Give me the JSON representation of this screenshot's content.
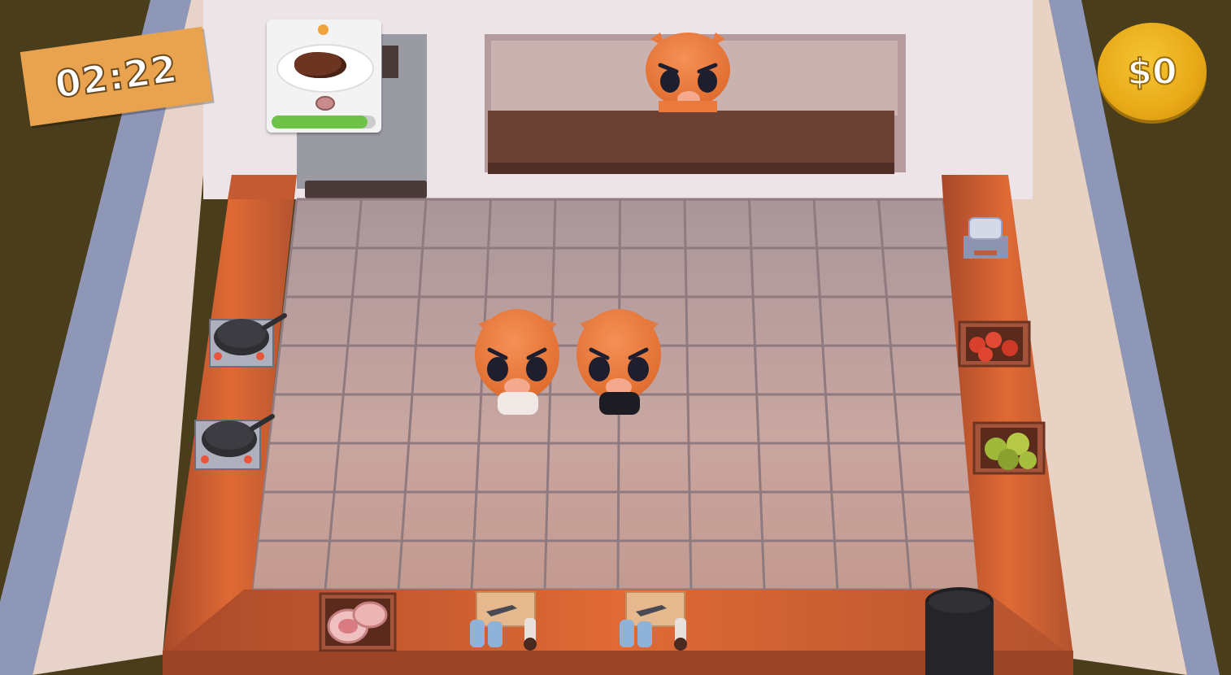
{
  "hud": {
    "timer": "02:22",
    "money": "$0"
  },
  "order": {
    "dish_icon": "steak-icon",
    "ingredient_icon": "raw-meat-icon",
    "progress": 0.92,
    "colors": {
      "progress": "#6ec248",
      "indicator": "#f0a33a"
    }
  },
  "colors": {
    "floor": "#b79a9a",
    "counter": "#b4542f",
    "wall": "#e8d8d0",
    "background": "#4a3d1c",
    "coin": "#f2bb22",
    "timer_sign": "#e9a24e",
    "pig": "#ef7d3e"
  }
}
